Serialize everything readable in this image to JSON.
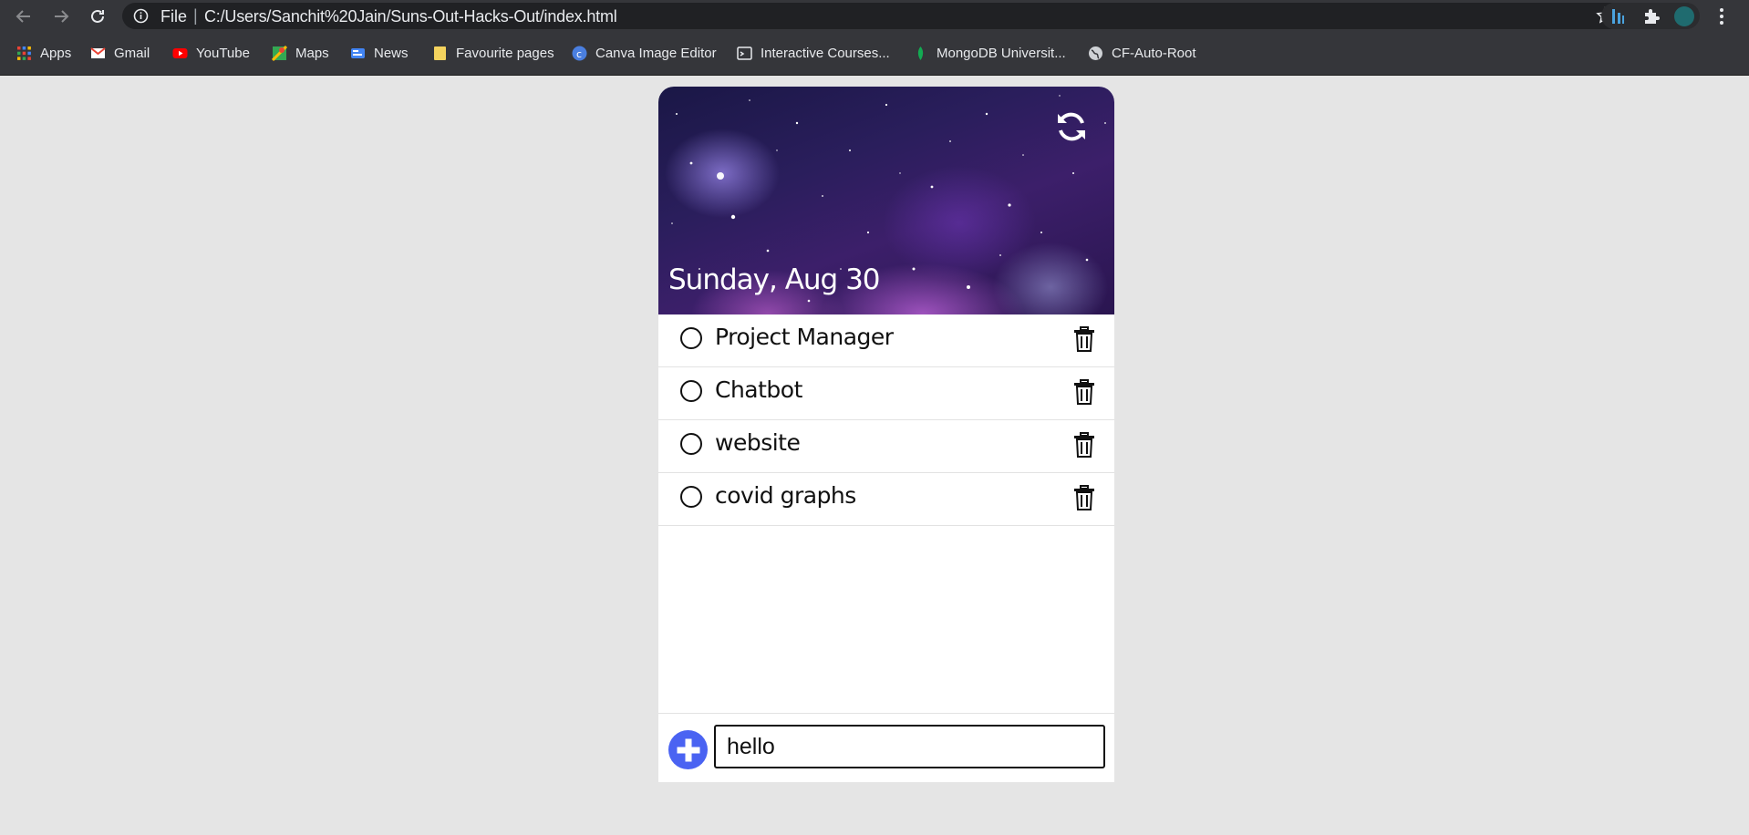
{
  "browser": {
    "file_label": "File",
    "url": "C:/Users/Sanchit%20Jain/Suns-Out-Hacks-Out/index.html",
    "bookmarks": [
      {
        "label": "Apps",
        "icon": "apps-grid-icon"
      },
      {
        "label": "Gmail",
        "icon": "gmail-icon"
      },
      {
        "label": "YouTube",
        "icon": "youtube-icon"
      },
      {
        "label": "Maps",
        "icon": "maps-icon"
      },
      {
        "label": "News",
        "icon": "news-icon"
      },
      {
        "label": "Favourite pages",
        "icon": "folder-icon"
      },
      {
        "label": "Canva Image Editor",
        "icon": "canva-icon"
      },
      {
        "label": "Interactive Courses...",
        "icon": "terminal-icon"
      },
      {
        "label": "MongoDB Universit...",
        "icon": "mongodb-leaf-icon"
      },
      {
        "label": "CF-Auto-Root",
        "icon": "globe-icon"
      }
    ]
  },
  "app": {
    "date": "Sunday, Aug 30",
    "tasks": [
      {
        "text": "Project Manager",
        "done": false
      },
      {
        "text": "Chatbot",
        "done": false
      },
      {
        "text": "website",
        "done": false
      },
      {
        "text": "covid graphs",
        "done": false
      }
    ],
    "input_value": "hello",
    "accent_color": "#4a63f2"
  }
}
